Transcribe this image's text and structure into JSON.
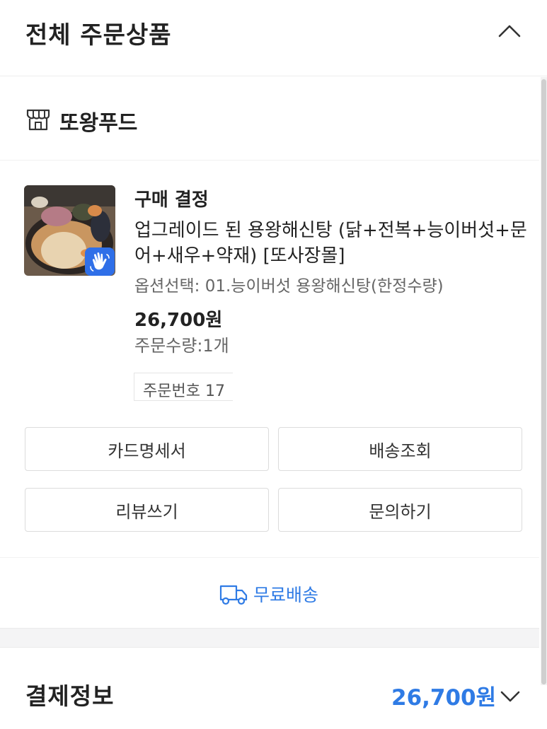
{
  "header": {
    "title": "전체 주문상품",
    "collapse_icon": "chevron-up-icon"
  },
  "store": {
    "name": "또왕푸드",
    "icon": "store-icon"
  },
  "order": {
    "status": "구매 결정",
    "product_name": "업그레이드 된 용왕해신탕 (닭+전복+능이버섯+문어+새우+약재) [또사장몰]",
    "option": "옵션선택: 01.능이버섯 용왕해신탕(한정수량)",
    "price": "26,700원",
    "quantity": "주문수량:1개",
    "order_number": "주문번호 17",
    "badge_icon": "hand-icon",
    "badge_color": "#2f6fe8"
  },
  "actions": {
    "card_statement": "카드명세서",
    "track_delivery": "배송조회",
    "write_review": "리뷰쓰기",
    "inquiry": "문의하기"
  },
  "shipping": {
    "label": "무료배송",
    "icon": "truck-icon",
    "color": "#2f7be5"
  },
  "payment": {
    "title": "결제정보",
    "amount": "26,700원",
    "expand_icon": "chevron-down-icon",
    "amount_color": "#2f7be5"
  }
}
